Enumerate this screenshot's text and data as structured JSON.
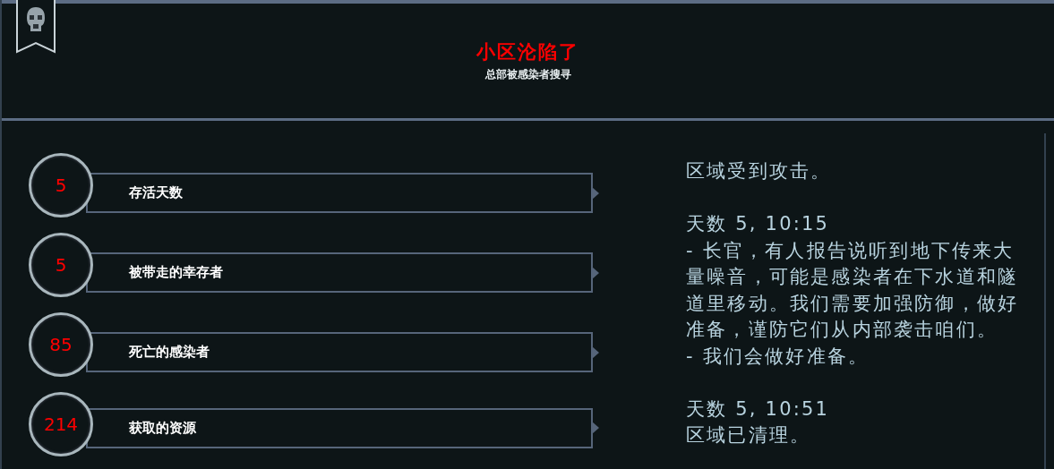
{
  "header": {
    "title": "小区沦陷了",
    "subtitle": "总部被感染者搜寻"
  },
  "stats": [
    {
      "value": "5",
      "label": "存活天数"
    },
    {
      "value": "5",
      "label": "被带走的幸存者"
    },
    {
      "value": "85",
      "label": "死亡的感染者"
    },
    {
      "value": "214",
      "label": "获取的资源"
    }
  ],
  "log": [
    {
      "lines": [
        "区域受到攻击。"
      ]
    },
    {
      "time": "天数 5, 10:15",
      "lines": [
        "- 长官，有人报告说听到地下传来大量噪音，可能是感染者在下水道和隧道里移动。我们需要加强防御，做好准备，谨防它们从内部袭击咱们。",
        "- 我们会做好准备。"
      ]
    },
    {
      "time": "天数 5, 10:51",
      "lines": [
        "区域已清理。"
      ]
    }
  ]
}
